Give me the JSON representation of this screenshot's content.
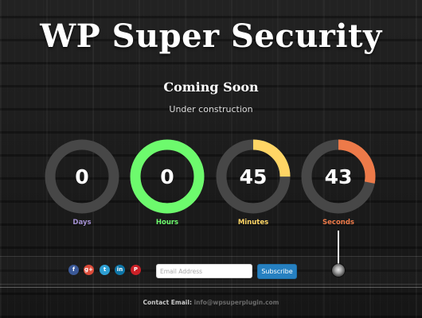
{
  "header": {
    "title": "WP Super Security",
    "subtitle": "Coming Soon",
    "tagline": "Under construction"
  },
  "countdown": [
    {
      "value": "0",
      "label": "Days",
      "progress": 0,
      "color": "#a28fd0"
    },
    {
      "value": "0",
      "label": "Hours",
      "progress": 1.0,
      "color": "#6dfa6d"
    },
    {
      "value": "45",
      "label": "Minutes",
      "progress": 0.25,
      "color": "#ffd565"
    },
    {
      "value": "43",
      "label": "Seconds",
      "progress": 0.28,
      "color": "#ed7a49"
    }
  ],
  "ring_track_color": "#474747",
  "social": [
    {
      "icon": "facebook-icon",
      "glyph": "f",
      "color": "#3b5998"
    },
    {
      "icon": "google-plus-icon",
      "glyph": "g+",
      "color": "#dd4b39"
    },
    {
      "icon": "twitter-icon",
      "glyph": "t",
      "color": "#2e9fd3"
    },
    {
      "icon": "linkedin-icon",
      "glyph": "in",
      "color": "#0e76a8"
    },
    {
      "icon": "pinterest-icon",
      "glyph": "P",
      "color": "#cb2027"
    }
  ],
  "subscribe": {
    "placeholder": "Email Address",
    "button_label": "Subscribe"
  },
  "footer": {
    "contact_label": "Contact Email:",
    "email": "info@wpsuperplugin.com"
  }
}
